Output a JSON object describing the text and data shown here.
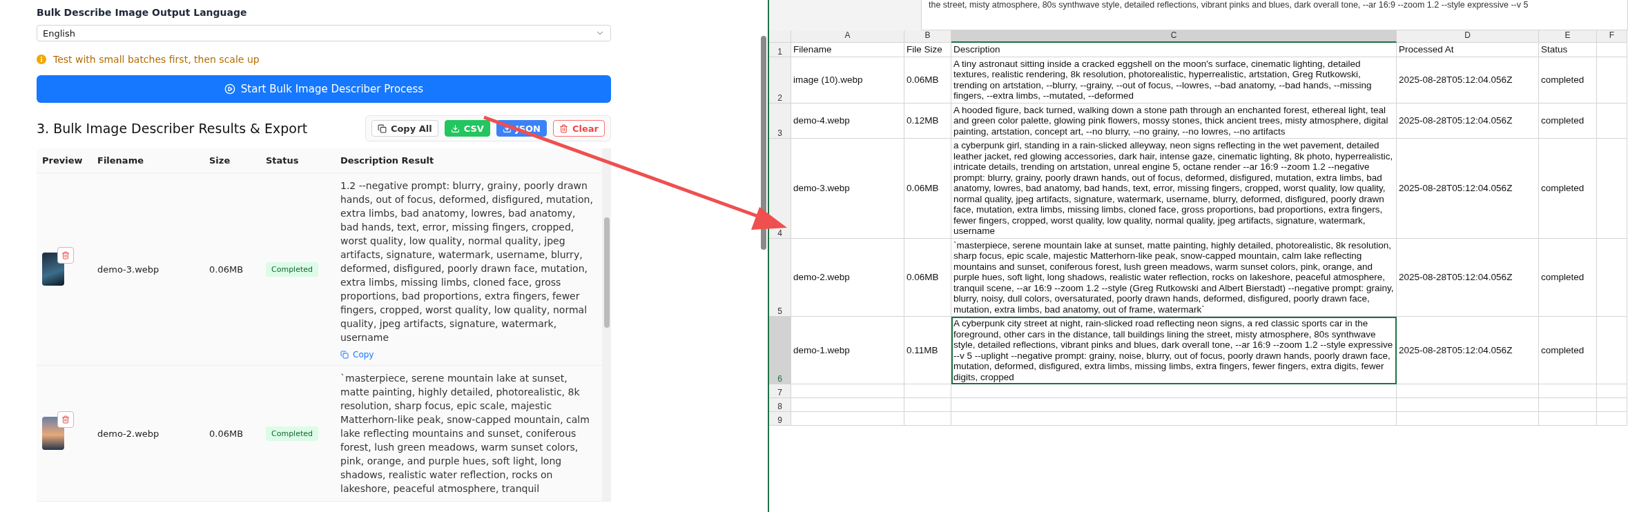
{
  "settings": {
    "language_label": "Bulk Describe Image Output Language",
    "language_value": "English",
    "tip": "Test with small batches first, then scale up",
    "start_button": "Start Bulk Image Describer Process"
  },
  "results": {
    "title": "3. Bulk Image Describer Results & Export",
    "actions": [
      {
        "label": "Copy All",
        "kind": "outline"
      },
      {
        "label": "CSV",
        "kind": "success"
      },
      {
        "label": "JSON",
        "kind": "primary"
      },
      {
        "label": "Clear",
        "kind": "danger"
      }
    ],
    "columns": [
      "Preview",
      "Filename",
      "Size",
      "Status",
      "Description Result"
    ],
    "rows": [
      {
        "filename": "demo-3.webp",
        "size": "0.06MB",
        "status": "Completed",
        "description": "1.2 --negative prompt: blurry, grainy, poorly drawn hands, out of focus, deformed, disfigured, mutation, extra limbs, bad anatomy, lowres, bad anatomy, bad hands, text, error, missing fingers, cropped, worst quality, low quality, normal quality, jpeg artifacts, signature, watermark, username, blurry, deformed, disfigured, poorly drawn face, mutation, extra limbs, missing limbs, cloned face, gross proportions, bad proportions, extra fingers, fewer fingers, cropped, worst quality, low quality, normal quality, jpeg artifacts, signature, watermark, username",
        "copy_label": "Copy"
      },
      {
        "filename": "demo-2.webp",
        "size": "0.06MB",
        "status": "Completed",
        "description": "`masterpiece, serene mountain lake at sunset, matte painting, highly detailed, photorealistic, 8k resolution, sharp focus, epic scale, majestic Matterhorn-like peak, snow-capped mountain, calm lake reflecting mountains and sunset, coniferous forest, lush green meadows, warm sunset colors, pink, orange, and purple hues, soft light, long shadows, realistic water reflection, rocks on lakeshore, peaceful atmosphere, tranquil"
      }
    ]
  },
  "spreadsheet": {
    "formula_text": "the street, misty atmosphere, 80s synthwave style, detailed reflections, vibrant pinks and blues, dark overall tone, --ar 16:9 --zoom 1.2 --style expressive --v 5",
    "columns": [
      {
        "label": "A",
        "selected": false
      },
      {
        "label": "B",
        "selected": false
      },
      {
        "label": "C",
        "selected": true
      },
      {
        "label": "D",
        "selected": false
      },
      {
        "label": "E",
        "selected": false
      },
      {
        "label": "F",
        "selected": false
      }
    ],
    "rows": [
      {
        "number": "1",
        "selected": false,
        "cells": [
          "Filename",
          "File Size",
          "Description",
          "Processed At",
          "Status"
        ]
      },
      {
        "number": "2",
        "selected": false,
        "cells": [
          "image (10).webp",
          "0.06MB",
          "A tiny astronaut sitting inside a cracked eggshell on the moon's surface, cinematic lighting, detailed textures, realistic rendering, 8k resolution, photorealistic, hyperrealistic, artstation, Greg Rutkowski, trending on artstation, --blurry, --grainy, --out of focus, --lowres, --bad anatomy, --bad hands, --missing fingers, --extra limbs, --mutated, --deformed",
          "2025-08-28T05:12:04.056Z",
          "completed"
        ]
      },
      {
        "number": "3",
        "selected": false,
        "cells": [
          "demo-4.webp",
          "0.12MB",
          "A hooded figure, back turned, walking down a stone path through an enchanted forest, ethereal light, teal and green color palette, glowing pink flowers, mossy stones, thick ancient trees, misty atmosphere, digital painting, artstation, concept art, --no blurry, --no grainy, --no lowres, --no artifacts",
          "2025-08-28T05:12:04.056Z",
          "completed"
        ]
      },
      {
        "number": "4",
        "selected": false,
        "cells": [
          "demo-3.webp",
          "0.06MB",
          "a cyberpunk girl, standing in a rain-slicked alleyway, neon signs reflecting in the wet pavement, detailed leather jacket, red glowing accessories, dark hair, intense gaze, cinematic lighting, 8k photo, hyperrealistic, intricate details, trending on artstation, unreal engine 5, octane render --ar 16:9 --zoom 1.2 --negative prompt: blurry, grainy, poorly drawn hands, out of focus, deformed, disfigured, mutation, extra limbs, bad anatomy, lowres, bad anatomy, bad hands, text, error, missing fingers, cropped, worst quality, low quality, normal quality, jpeg artifacts, signature, watermark, username, blurry, deformed, disfigured, poorly drawn face, mutation, extra limbs, missing limbs, cloned face, gross proportions, bad proportions, extra fingers, fewer fingers, cropped, worst quality, low quality, normal quality, jpeg artifacts, signature, watermark, username",
          "2025-08-28T05:12:04.056Z",
          "completed"
        ]
      },
      {
        "number": "5",
        "selected": false,
        "cells": [
          "demo-2.webp",
          "0.06MB",
          "`masterpiece,  serene mountain lake at sunset,  matte painting,  highly detailed,  photorealistic,  8k resolution,  sharp focus,  epic scale,  majestic Matterhorn-like peak,  snow-capped mountain,  calm lake reflecting mountains and sunset,  coniferous forest,  lush green meadows,  warm sunset colors,  pink, orange, and purple hues,  soft light,  long shadows,  realistic water reflection,  rocks on lakeshore,  peaceful atmosphere,  tranquil scene,  --ar 16:9 --zoom 1.2 --style (Greg Rutkowski and Albert Bierstadt) --negative prompt: grainy, blurry, noisy, dull colors, oversaturated, poorly drawn hands, deformed, disfigured, poorly drawn face, mutation, extra limbs, bad anatomy, out of frame, watermark`",
          "2025-08-28T05:12:04.056Z",
          "completed"
        ]
      },
      {
        "number": "6",
        "selected": true,
        "cells": [
          "demo-1.webp",
          "0.11MB",
          "A cyberpunk city street at night, rain-slicked road reflecting neon signs, a red classic sports car in the foreground, other cars in the distance, tall buildings lining the street, misty atmosphere, 80s synthwave style, detailed reflections, vibrant pinks and blues, dark overall tone,  --ar 16:9 --zoom 1.2 --style expressive --v 5 --uplight  --negative prompt: grainy, noise, blurry, out of focus, poorly drawn hands, poorly drawn face, mutation, deformed, disfigured, extra limbs, missing limbs, extra fingers, fewer fingers, extra digits, fewer digits, cropped",
          "2025-08-28T05:12:04.056Z",
          "completed"
        ]
      },
      {
        "number": "7",
        "selected": false,
        "cells": [
          "",
          "",
          "",
          "",
          ""
        ]
      },
      {
        "number": "8",
        "selected": false,
        "cells": [
          "",
          "",
          "",
          "",
          ""
        ]
      },
      {
        "number": "9",
        "selected": false,
        "cells": [
          "",
          "",
          "",
          "",
          ""
        ]
      }
    ]
  }
}
